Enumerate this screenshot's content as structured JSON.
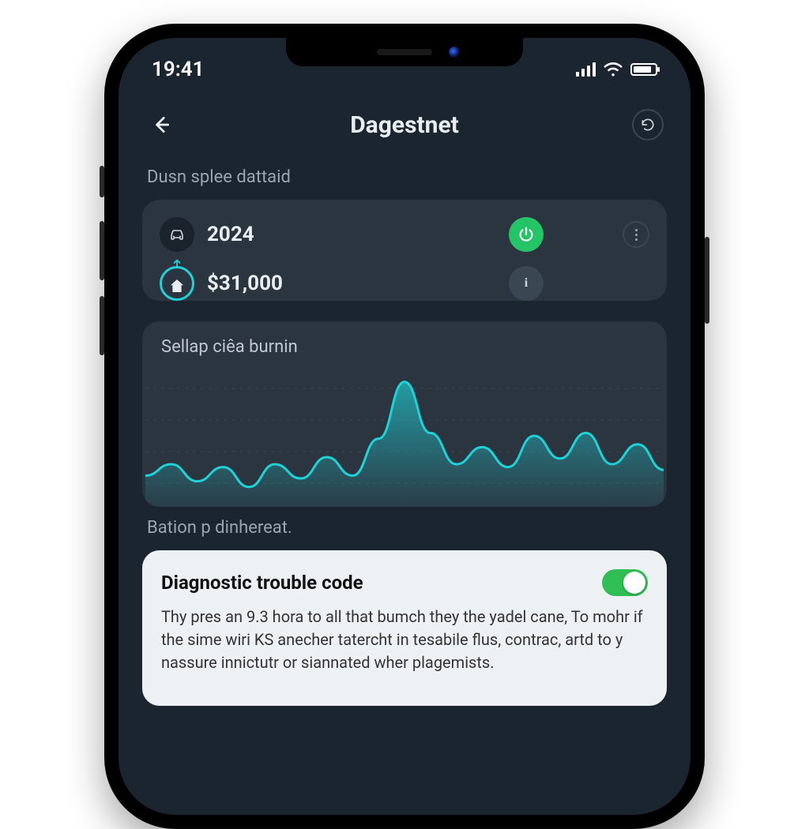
{
  "status": {
    "time": "19:41"
  },
  "nav": {
    "title": "Dagestnet"
  },
  "overview": {
    "section_label": "Dusn splee dattaid",
    "year_value": "2024",
    "amount_value": "$31,000",
    "info_glyph": "i"
  },
  "chart": {
    "title": "Sellap ciêa burnin"
  },
  "section2_label": "Bation p dinhereat.",
  "dtc": {
    "title": "Diagnostic trouble code",
    "body": "Thy pres an 9.3 hora to all that bumch they the yadel cane, To mohr if the sime wiri KS anecher tatercht in tesabile flus, contrac, artd to y nassure innictutr or siannated wher plagemists.",
    "toggle_on": true
  },
  "colors": {
    "bg": "#1b2530",
    "card": "#2b3540",
    "accent_cyan": "#1fd2d8",
    "accent_green": "#25c466",
    "toggle_green": "#2fbf55",
    "text_muted": "#9aa5ae"
  },
  "chart_data": {
    "type": "area",
    "title": "Sellap ciêa burnin",
    "xlabel": "",
    "ylabel": "",
    "ylim": [
      0,
      100
    ],
    "x": [
      0,
      5,
      10,
      15,
      20,
      25,
      30,
      35,
      40,
      45,
      50,
      55,
      60,
      65,
      70,
      75,
      80,
      85,
      90,
      95,
      100
    ],
    "values": [
      22,
      30,
      18,
      28,
      14,
      30,
      20,
      35,
      22,
      48,
      88,
      52,
      30,
      42,
      28,
      50,
      34,
      52,
      30,
      44,
      26
    ]
  }
}
